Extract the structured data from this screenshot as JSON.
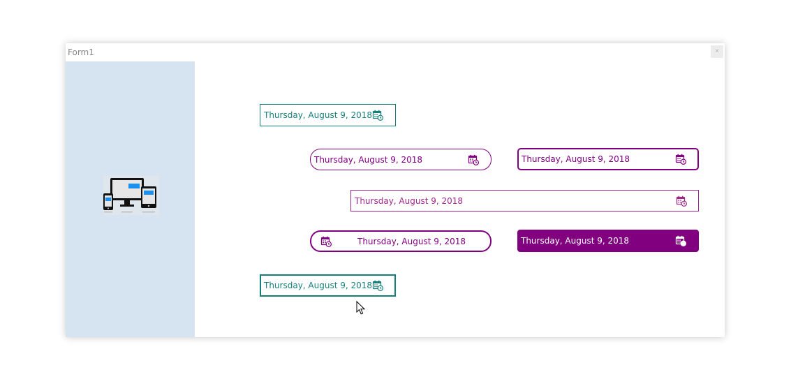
{
  "window": {
    "title": "Form1",
    "close_label": "×"
  },
  "pickers": [
    {
      "value": "Thursday, August 9, 2018",
      "style": "teal"
    },
    {
      "value": "Thursday, August 9, 2018",
      "style": "purple-rounded"
    },
    {
      "value": "Thursday, August 9, 2018",
      "style": "purple-rect"
    },
    {
      "value": "Thursday, August 9, 2018",
      "style": "magenta-wide"
    },
    {
      "value": "Thursday, August 9, 2018",
      "style": "purple-rounded-icon-left"
    },
    {
      "value": "Thursday, August 9, 2018",
      "style": "purple-filled"
    },
    {
      "value": "Thursday, August 9, 2018",
      "style": "teal-focused"
    }
  ],
  "colors": {
    "teal": "#167f7a",
    "purple": "#800080",
    "magenta": "#a0278a",
    "side_panel": "#d6e4f2"
  },
  "icons": [
    "calendar-icon",
    "devices-icon",
    "close-icon",
    "mouse-cursor-icon"
  ]
}
